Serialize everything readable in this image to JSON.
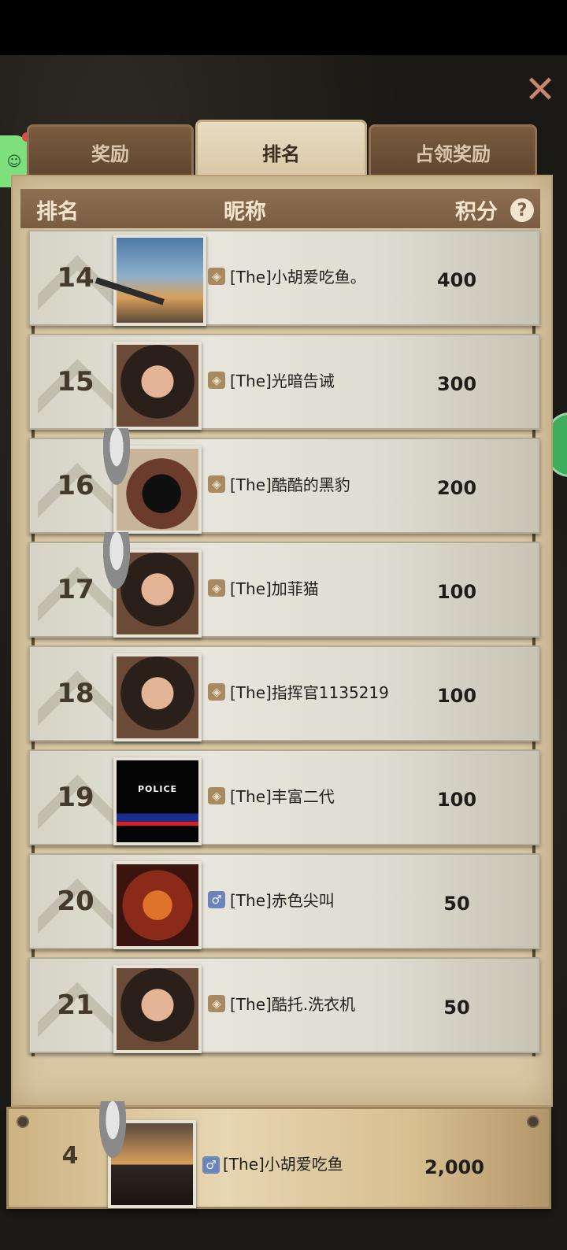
{
  "tabs": [
    {
      "label": "奖励",
      "active": false
    },
    {
      "label": "排名",
      "active": true
    },
    {
      "label": "占领奖励",
      "active": false
    }
  ],
  "header": {
    "rank": "排名",
    "nickname": "昵称",
    "points": "积分"
  },
  "rows": [
    {
      "rank": "14",
      "name": "[The]小胡爱吃鱼。",
      "score": "400",
      "gender_icon": "hidden-eye-icon",
      "avatar_icon": "fighter-jet-avatar"
    },
    {
      "rank": "15",
      "name": "[The]光暗告诫",
      "score": "300",
      "gender_icon": "hidden-eye-icon",
      "avatar_icon": "woman-portrait-avatar"
    },
    {
      "rank": "16",
      "name": "[The]酷酷的黑豹",
      "score": "200",
      "gender_icon": "hidden-eye-icon",
      "avatar_icon": "black-cat-avatar"
    },
    {
      "rank": "17",
      "name": "[The]加菲猫",
      "score": "100",
      "gender_icon": "hidden-eye-icon",
      "avatar_icon": "woman-portrait-avatar"
    },
    {
      "rank": "18",
      "name": "[The]指挥官1135219",
      "score": "100",
      "gender_icon": "hidden-eye-icon",
      "avatar_icon": "woman-portrait-avatar"
    },
    {
      "rank": "19",
      "name": "[The]丰富二代",
      "score": "100",
      "gender_icon": "hidden-eye-icon",
      "avatar_icon": "police-avatar"
    },
    {
      "rank": "20",
      "name": "[The]赤色尖叫",
      "score": "50",
      "gender_icon": "male-icon",
      "avatar_icon": "dragon-avatar"
    },
    {
      "rank": "21",
      "name": "[The]酷托.洗衣机",
      "score": "50",
      "gender_icon": "hidden-eye-icon",
      "avatar_icon": "woman-portrait-avatar"
    }
  ],
  "police_badge_text": "POLICE",
  "self": {
    "rank": "4",
    "name": "[The]小胡爱吃鱼",
    "score": "2,000",
    "gender_icon": "male-icon",
    "avatar_icon": "sunset-person-avatar"
  },
  "icons": {
    "close": "close-icon",
    "help": "question-icon",
    "hidden": "◈",
    "male": "♂"
  },
  "colors": {
    "tab_active": "#e0d2b4",
    "tab_inactive": "#6b4f37",
    "header_bar": "#846449",
    "close": "#c9866a"
  }
}
